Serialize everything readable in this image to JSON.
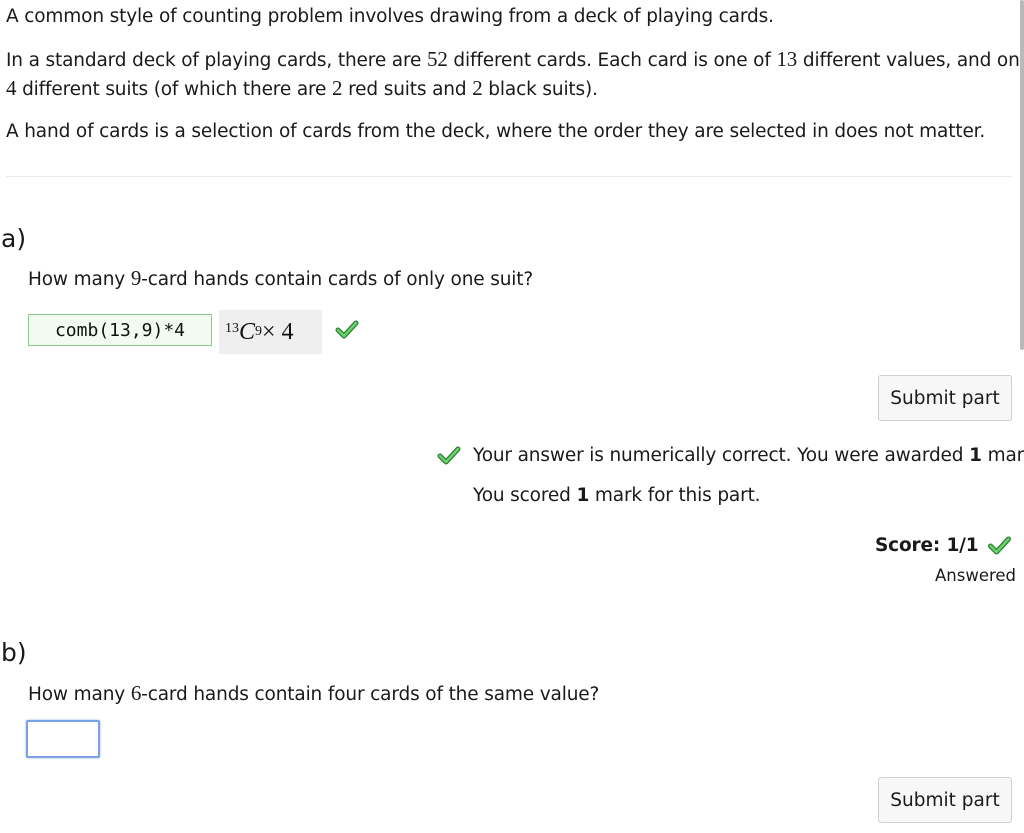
{
  "intro": {
    "line1": "A common style of counting problem involves drawing from a deck of playing cards.",
    "line2_a": "In a standard deck of playing cards, there are ",
    "line2_n1": "52",
    "line2_b": " different cards. Each card is one of ",
    "line2_n2": "13",
    "line2_c": " different values, and one of",
    "line3_n1": "4",
    "line3_a": " different suits (of which there are ",
    "line3_n2": "2",
    "line3_b": " red suits and ",
    "line3_n3": "2",
    "line3_c": " black suits).",
    "line4": "A hand of cards is a selection of cards from the deck, where the order they are selected in does not matter."
  },
  "part_a": {
    "label": "a)",
    "question_a": "How many ",
    "question_n": "9",
    "question_b": "-card hands contain cards of only one suit?",
    "answer_value": "comb(13,9)*4",
    "preview_sup": "13",
    "preview_c": "C",
    "preview_sub": "9",
    "preview_times": " × 4",
    "submit_label": "Submit part",
    "feedback_a": "Your answer is numerically correct. You were awarded ",
    "feedback_n": "1",
    "feedback_b": " mark.",
    "scored_a": "You scored ",
    "scored_n": "1",
    "scored_b": " mark for this part.",
    "score_label": "Score: 1/1",
    "status": "Answered",
    "correct_color": "#4caf50"
  },
  "part_b": {
    "label": "b)",
    "question_a": "How many ",
    "question_n": "6",
    "question_b": "-card hands contain four cards of the same value?",
    "answer_value": "",
    "submit_label": "Submit part"
  }
}
